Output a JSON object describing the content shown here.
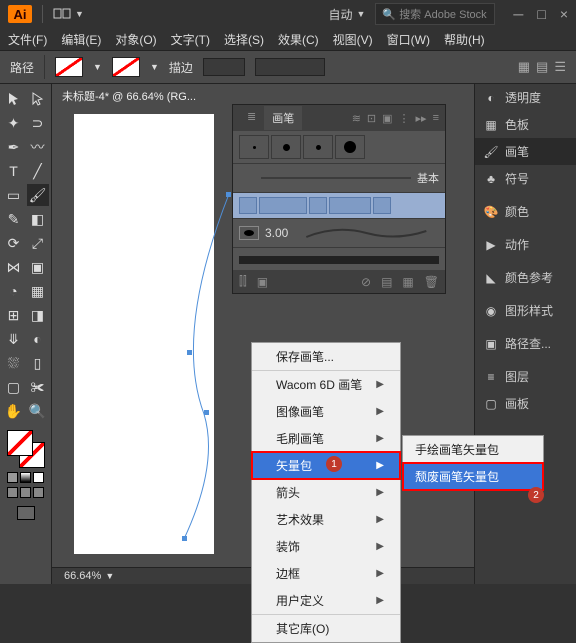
{
  "app": {
    "logo": "Ai",
    "layout_label": "自动",
    "search_placeholder": "搜索 Adobe Stock"
  },
  "menus": [
    "文件(F)",
    "编辑(E)",
    "对象(O)",
    "文字(T)",
    "选择(S)",
    "效果(C)",
    "视图(V)",
    "窗口(W)",
    "帮助(H)"
  ],
  "options": {
    "path_label": "路径",
    "stroke_label": "描边"
  },
  "doc": {
    "tab": "未标题-4* @ 66.64% (RG...",
    "zoom": "66.64%"
  },
  "right_panels": [
    "透明度",
    "色板",
    "画笔",
    "符号",
    "颜色",
    "动作",
    "颜色参考",
    "图形样式",
    "路径查...",
    "图层",
    "画板"
  ],
  "active_panel": "画笔",
  "brushes": {
    "tabs": [
      "画笔"
    ],
    "basic_label": "基本",
    "callig_size": "3.00"
  },
  "context_menu": {
    "items": [
      {
        "label": "保存画笔...",
        "arrow": false,
        "sep": true
      },
      {
        "label": "Wacom 6D 画笔",
        "arrow": true
      },
      {
        "label": "图像画笔",
        "arrow": true
      },
      {
        "label": "毛刷画笔",
        "arrow": true
      },
      {
        "label": "矢量包",
        "arrow": true,
        "highlight": true,
        "boxed": true
      },
      {
        "label": "箭头",
        "arrow": true
      },
      {
        "label": "艺术效果",
        "arrow": true
      },
      {
        "label": "装饰",
        "arrow": true
      },
      {
        "label": "边框",
        "arrow": true
      },
      {
        "label": "用户定义",
        "arrow": true,
        "sep": true
      },
      {
        "label": "其它库(O)",
        "arrow": false
      }
    ]
  },
  "submenu": {
    "items": [
      {
        "label": "手绘画笔矢量包"
      },
      {
        "label": "颓废画笔矢量包",
        "highlight": true,
        "boxed": true
      }
    ]
  },
  "badges": {
    "one": "1",
    "two": "2"
  }
}
